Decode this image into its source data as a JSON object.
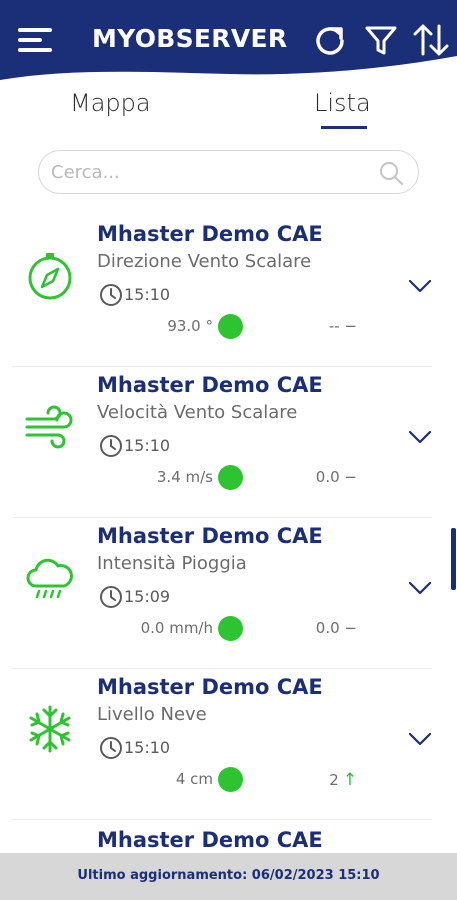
{
  "header": {
    "title": "MYOBSERVER",
    "menu_icon": "hamburger-menu-icon",
    "refresh_icon": "refresh-icon",
    "filter_icon": "filter-icon",
    "sort_icon": "sort-icon",
    "brand_color": "#1b2e78"
  },
  "tabs": [
    {
      "label": "Mappa",
      "active": false
    },
    {
      "label": "Lista",
      "active": true
    }
  ],
  "search": {
    "placeholder": "Cerca..."
  },
  "cards": [
    {
      "station": "Mhaster Demo CAE",
      "sensor": "Direzione Vento Scalare",
      "time": "15:10",
      "value": "93.0 °",
      "status_color": "#2ec431",
      "trend": "-- −",
      "icon": "compass-icon"
    },
    {
      "station": "Mhaster Demo CAE",
      "sensor": "Velocità Vento Scalare",
      "time": "15:10",
      "value": "3.4 m/s",
      "status_color": "#2ec431",
      "trend": "0.0 −",
      "icon": "wind-icon"
    },
    {
      "station": "Mhaster Demo CAE",
      "sensor": "Intensità Pioggia",
      "time": "15:09",
      "value": "0.0 mm/h",
      "status_color": "#2ec431",
      "trend": "0.0 −",
      "icon": "rain-cloud-icon"
    },
    {
      "station": "Mhaster Demo CAE",
      "sensor": "Livello Neve",
      "time": "15:10",
      "value": "4 cm",
      "status_color": "#2ec431",
      "trend": "2",
      "trend_arrow": "↑",
      "icon": "snowflake-icon"
    }
  ],
  "partial_card": {
    "station": "Mhaster Demo CAE"
  },
  "footer": {
    "status": "Ultimo aggiornamento: 06/02/2023 15:10"
  }
}
